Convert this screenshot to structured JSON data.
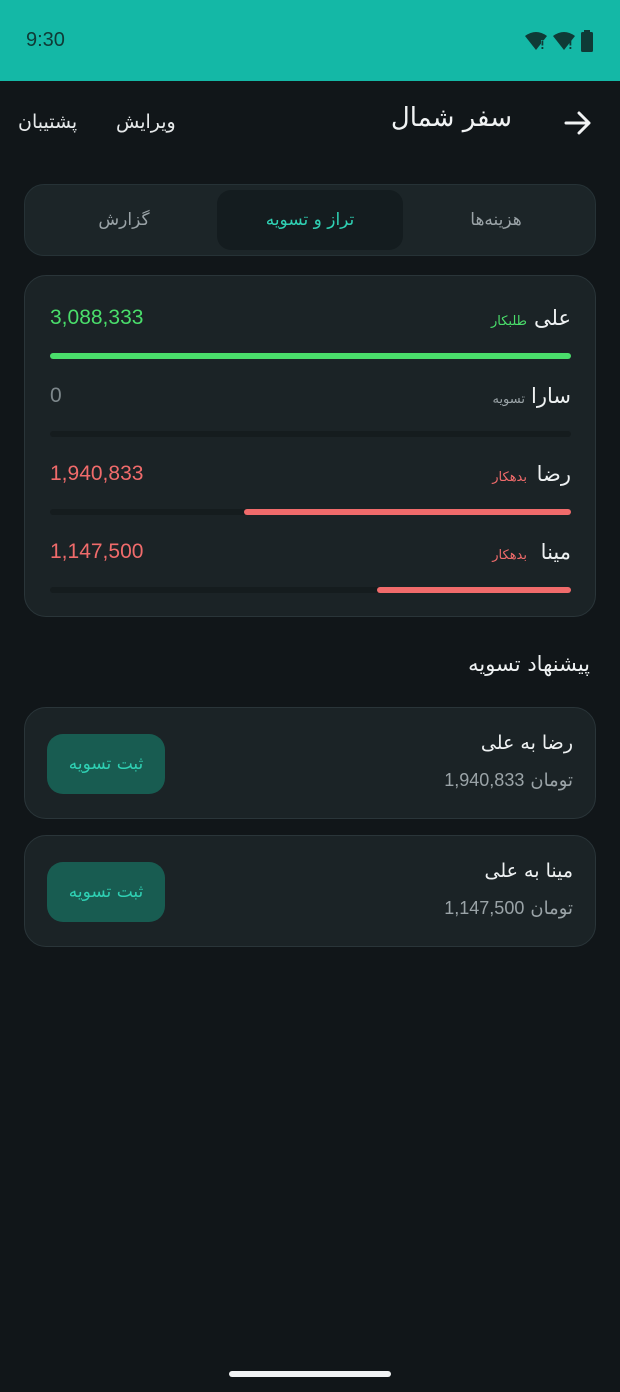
{
  "status_bar": {
    "time": "9:30"
  },
  "app_bar": {
    "title": "سفر شمال",
    "edit_label": "ویرایش",
    "support_label": "پشتیبان"
  },
  "tabs": [
    {
      "label": "هزینه‌ها",
      "active": false
    },
    {
      "label": "تراز و تسویه",
      "active": true
    },
    {
      "label": "گزارش",
      "active": false
    }
  ],
  "balances": [
    {
      "name": "علی",
      "status": "طلبکار",
      "amount": "3,088,333",
      "bar_fraction": 1.0,
      "color": "#4ade6b"
    },
    {
      "name": "سارا",
      "status": "تسویه",
      "amount": "0",
      "bar_fraction": 0.0,
      "color": "#9aa3a7"
    },
    {
      "name": "رضا",
      "status": "بدهکار",
      "amount": "1,940,833",
      "bar_fraction": 0.628,
      "color": "#f06b6b"
    },
    {
      "name": "مینا",
      "status": "بدهکار",
      "amount": "1,147,500",
      "bar_fraction": 0.372,
      "color": "#f06b6b"
    }
  ],
  "suggestions_title": "پیشنهاد تسویه",
  "suggestions": [
    {
      "title": "رضا به علی",
      "amount": "1,940,833",
      "currency": "تومان",
      "button_label": "ثبت تسویه"
    },
    {
      "title": "مینا به علی",
      "amount": "1,147,500",
      "currency": "تومان",
      "button_label": "ثبت تسویه"
    }
  ],
  "colors": {
    "status_bar": "#14b8a6",
    "background": "#111619",
    "accent": "#2fd0b3",
    "creditor": "#4ade6b",
    "debtor": "#f06b6b"
  }
}
